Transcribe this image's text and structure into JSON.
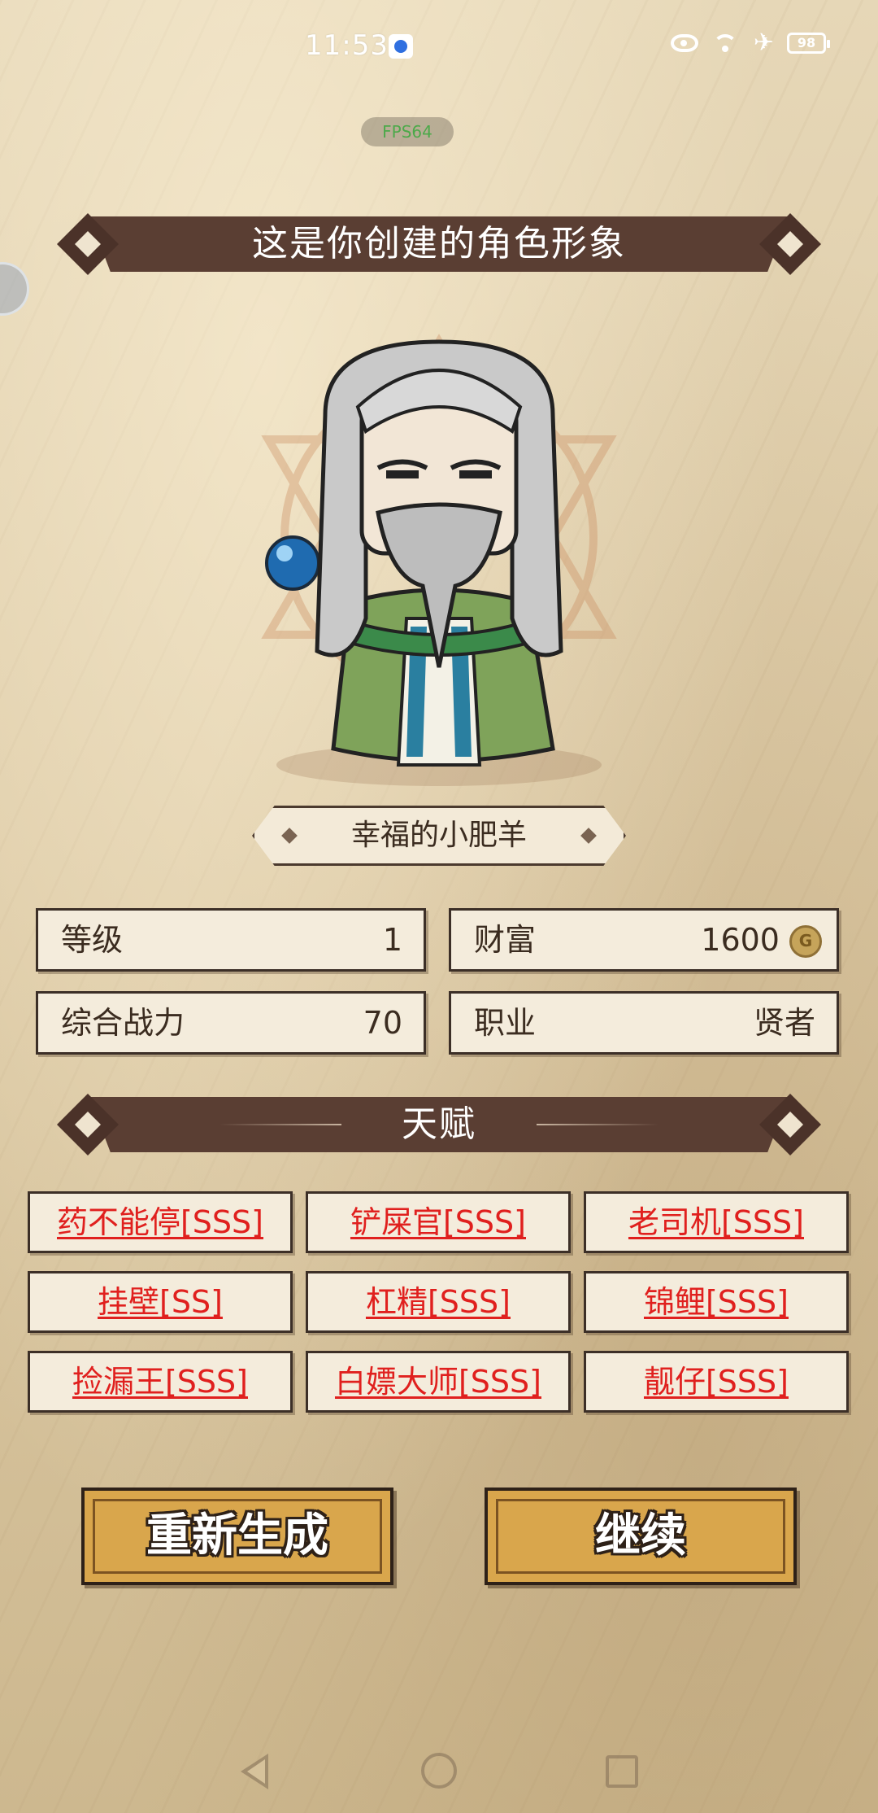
{
  "status_bar": {
    "time": "11:53",
    "battery": "98"
  },
  "fps_badge": "FPS64",
  "header": {
    "title": "这是你创建的角色形象"
  },
  "character": {
    "name": "幸福的小肥羊"
  },
  "stats": {
    "level": {
      "label": "等级",
      "value": "1"
    },
    "wealth": {
      "label": "财富",
      "value": "1600"
    },
    "power": {
      "label": "综合战力",
      "value": "70"
    },
    "job": {
      "label": "职业",
      "value": "贤者"
    }
  },
  "talents": {
    "title": "天赋",
    "items": [
      "药不能停[SSS]",
      "铲屎官[SSS]",
      "老司机[SSS]",
      "挂壁[SS]",
      "杠精[SSS]",
      "锦鲤[SSS]",
      "捡漏王[SSS]",
      "白嫖大师[SSS]",
      "靓仔[SSS]"
    ]
  },
  "buttons": {
    "regenerate": "重新生成",
    "continue": "继续"
  },
  "icons": {
    "coin": "gold-coin-icon",
    "status": [
      "baidu-icon",
      "eye-icon",
      "wifi-icon",
      "airplane-icon",
      "battery-icon"
    ],
    "nav": [
      "back-icon",
      "home-icon",
      "recents-icon"
    ]
  }
}
